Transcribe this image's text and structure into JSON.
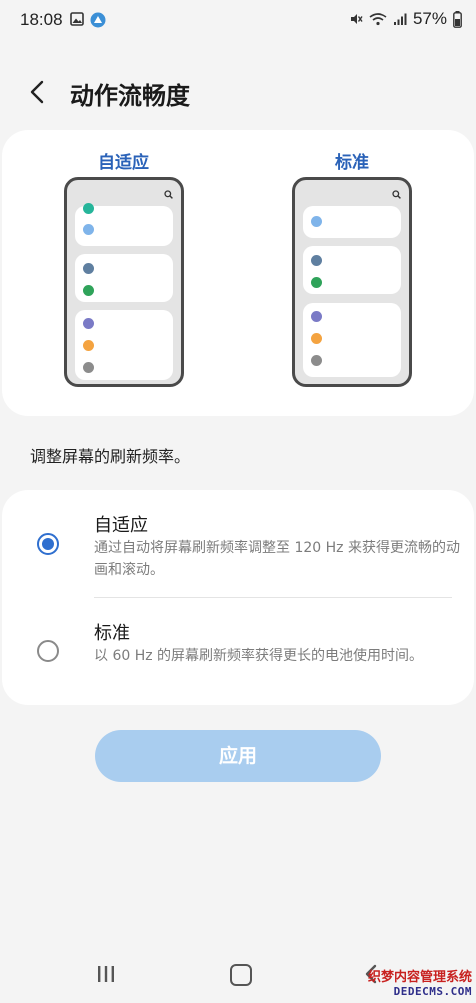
{
  "status_bar": {
    "time": "18:08",
    "battery": "57%"
  },
  "header": {
    "title": "动作流畅度"
  },
  "preview": {
    "adaptive_label": "自适应",
    "standard_label": "标准"
  },
  "hint": "调整屏幕的刷新频率。",
  "options": [
    {
      "title": "自适应",
      "description": "通过自动将屏幕刷新频率调整至 120 Hz 来获得更流畅的动画和滚动。",
      "selected": true
    },
    {
      "title": "标准",
      "description": "以 60 Hz 的屏幕刷新频率获得更长的电池使用时间。",
      "selected": false
    }
  ],
  "apply_label": "应用",
  "watermark": {
    "line1": "织梦内容管理系统",
    "line2": "DEDECMS.COM"
  },
  "colors": {
    "accent": "#2f6fcf",
    "label_blue": "#2a62b8",
    "apply_disabled": "#a9cdef",
    "dot_teal": "#26b59a",
    "dot_light_blue": "#7fb4ea",
    "dot_slate": "#5f7fa0",
    "dot_green": "#2fa35a",
    "dot_purple": "#7a7ac6",
    "dot_orange": "#f4a340",
    "dot_gray": "#8c8c8c"
  }
}
